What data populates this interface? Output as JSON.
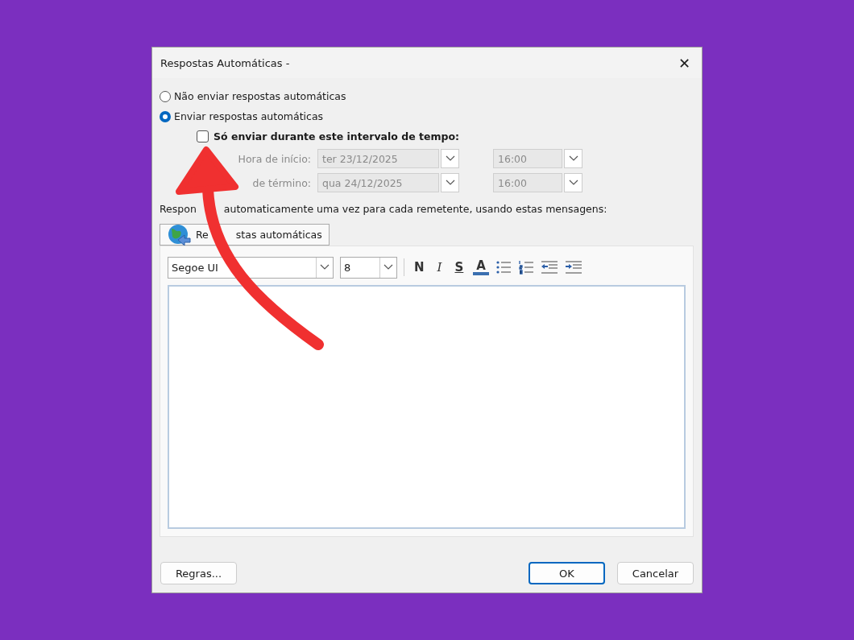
{
  "window": {
    "title": "Respostas Automáticas -",
    "close": "✕"
  },
  "mode_options": [
    {
      "label": "Não enviar respostas automáticas",
      "selected": false
    },
    {
      "label": "Enviar respostas automáticas",
      "selected": true
    }
  ],
  "time_range": {
    "label": "Só enviar durante este intervalo de tempo:",
    "checked": false
  },
  "schedule": [
    {
      "label": "Hora de início:",
      "date": "ter 23/12/2025",
      "time": "16:00"
    },
    {
      "label": "de término:",
      "date": "qua 24/12/2025",
      "time": "16:00"
    }
  ],
  "instructions": [
    "Respon",
    "automaticamente uma vez para cada remetente, usando estas mensagens:"
  ],
  "tabs": [
    {
      "label": [
        "Re",
        "stas automáticas"
      ],
      "selected": true
    }
  ],
  "toolbar": {
    "font": "Segoe UI",
    "size": "8",
    "buttons": [
      {
        "kind": "bold",
        "label": "N"
      },
      {
        "kind": "italic",
        "label": "I"
      },
      {
        "kind": "underline",
        "label": "S"
      },
      {
        "kind": "color",
        "label": "A"
      },
      {
        "kind": "bullets"
      },
      {
        "kind": "numbers"
      },
      {
        "kind": "outdent"
      },
      {
        "kind": "indent"
      }
    ]
  },
  "buttons": [
    {
      "label": "Regras...",
      "kind": "left",
      "default": false
    },
    {
      "label": "OK",
      "kind": "right",
      "default": true
    },
    {
      "label": "Cancelar",
      "kind": "right",
      "default": false
    }
  ]
}
